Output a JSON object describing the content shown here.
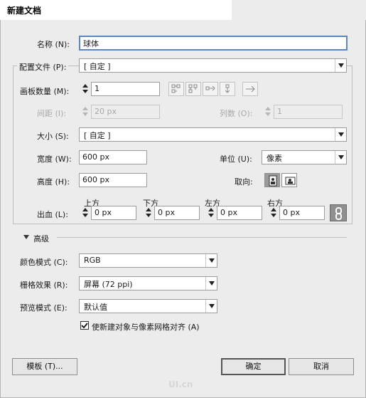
{
  "window": {
    "title": "新建文档"
  },
  "name_row": {
    "label": "名称 (N):",
    "value": "球体"
  },
  "profile": {
    "label": "配置文件 (P):",
    "value": "[ 自定 ]"
  },
  "artboards": {
    "count_label": "画板数量 (M):",
    "count_value": "1",
    "spacing_label": "间距 (I):",
    "spacing_value": "20 px",
    "columns_label": "列数 (O):",
    "columns_value": "1"
  },
  "size": {
    "label": "大小 (S):",
    "value": "[ 自定 ]"
  },
  "width": {
    "label": "宽度 (W):",
    "value": "600 px"
  },
  "height": {
    "label": "高度 (H):",
    "value": "600 px"
  },
  "units": {
    "label": "单位 (U):",
    "value": "像素"
  },
  "orientation": {
    "label": "取向:"
  },
  "bleed": {
    "label": "出血 (L):",
    "top_label": "上方",
    "top_value": "0 px",
    "bottom_label": "下方",
    "bottom_value": "0 px",
    "left_label": "左方",
    "left_value": "0 px",
    "right_label": "右方",
    "right_value": "0 px"
  },
  "advanced": {
    "title": "高级",
    "color_mode_label": "颜色模式 (C):",
    "color_mode_value": "RGB",
    "raster_label": "栅格效果 (R):",
    "raster_value": "屏幕 (72 ppi)",
    "preview_label": "预览模式 (E):",
    "preview_value": "默认值",
    "align_pixel_label": "使新建对象与像素网格对齐 (A)"
  },
  "footer": {
    "templates_label": "模板 (T)...",
    "ok_label": "确定",
    "cancel_label": "取消"
  },
  "watermark": "UI.cn"
}
